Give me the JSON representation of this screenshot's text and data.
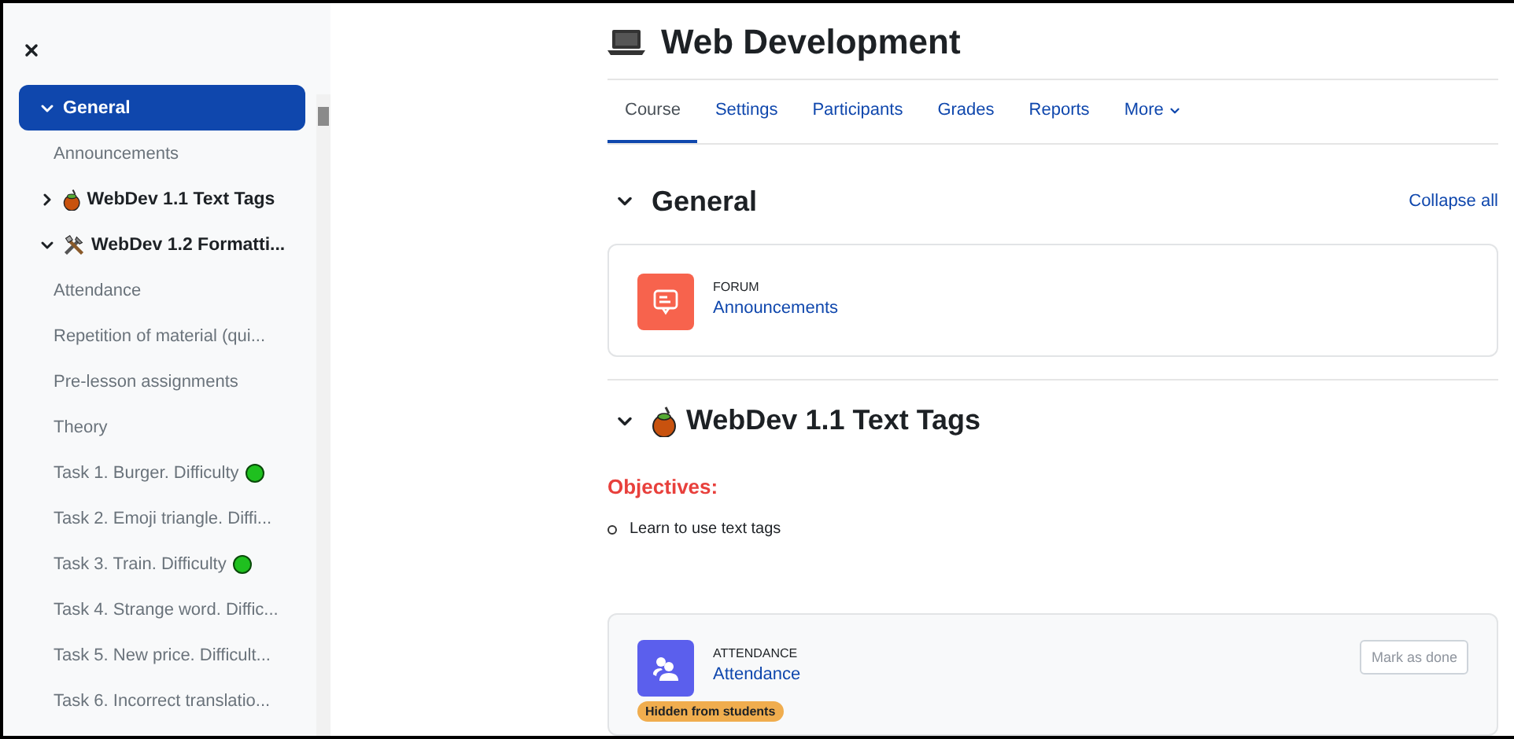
{
  "sidebar": {
    "items": [
      {
        "kind": "section",
        "label": "General",
        "expanded": true,
        "selected": true
      },
      {
        "kind": "activity",
        "label": "Announcements"
      },
      {
        "kind": "section",
        "label": "WebDev 1.1 Text Tags",
        "expanded": false,
        "selected": false
      },
      {
        "kind": "section",
        "label": "WebDev 1.2 Formatti...",
        "expanded": true,
        "selected": false
      },
      {
        "kind": "activity",
        "label": "Attendance"
      },
      {
        "kind": "activity",
        "label": "Repetition of material (qui..."
      },
      {
        "kind": "activity",
        "label": "Pre-lesson assignments"
      },
      {
        "kind": "activity",
        "label": "Theory"
      },
      {
        "kind": "activity",
        "label": "Task 1. Burger. Difficulty",
        "color": "#1fc01f"
      },
      {
        "kind": "activity",
        "label": "Task 2. Emoji triangle. Diffi..."
      },
      {
        "kind": "activity",
        "label": "Task 3. Train. Difficulty",
        "color": "#1fc01f"
      },
      {
        "kind": "activity",
        "label": "Task 4. Strange word. Diffic..."
      },
      {
        "kind": "activity",
        "label": "Task 5. New price. Difficult..."
      },
      {
        "kind": "activity",
        "label": "Task 6. Incorrect translatio..."
      }
    ]
  },
  "course": {
    "title": "Web Development",
    "tabs": [
      {
        "label": "Course",
        "selected": true
      },
      {
        "label": "Settings",
        "selected": false
      },
      {
        "label": "Participants",
        "selected": false
      },
      {
        "label": "Grades",
        "selected": false
      },
      {
        "label": "Reports",
        "selected": false
      },
      {
        "label": "More",
        "selected": false,
        "menu": true
      }
    ],
    "collapse_all": "Collapse all",
    "sections": [
      {
        "title": "General",
        "expanded": true,
        "activities": [
          {
            "kind": "forum",
            "type_label": "FORUM",
            "name": "Announcements"
          }
        ]
      },
      {
        "title": "WebDev 1.1 Text Tags",
        "expanded": true,
        "objectives_heading": "Objectives:",
        "objectives": [
          "Learn to use text tags"
        ],
        "activities": [
          {
            "kind": "attendance",
            "type_label": "ATTENDANCE",
            "name": "Attendance",
            "button": "Mark as done",
            "badge": "Hidden from students"
          }
        ]
      }
    ]
  }
}
